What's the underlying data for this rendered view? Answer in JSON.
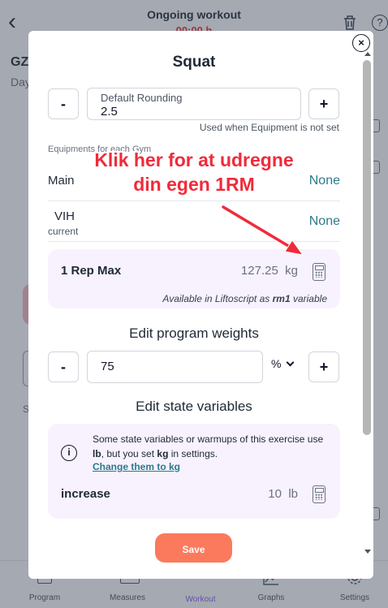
{
  "background": {
    "title": "Ongoing workout",
    "timer": "00:00 h",
    "program_short": "GZ",
    "day_short": "Day",
    "left_s": "S",
    "nav": [
      {
        "label": "Program"
      },
      {
        "label": "Measures"
      },
      {
        "label": "Workout"
      },
      {
        "label": "Graphs"
      },
      {
        "label": "Settings"
      }
    ]
  },
  "modal": {
    "title": "Squat",
    "rounding": {
      "label": "Default Rounding",
      "value": "2.5",
      "minus": "-",
      "plus": "+",
      "hint": "Used when Equipment is not set"
    },
    "gym_caption": "Equipments for each Gym",
    "gyms": [
      {
        "name": "Main",
        "sub": "",
        "value": "None"
      },
      {
        "name": "VIH",
        "sub": "current",
        "value": "None"
      }
    ],
    "one_rm": {
      "label": "1 Rep Max",
      "value": "127.25",
      "unit": "kg",
      "avail_prefix": "Available in Liftoscript as",
      "avail_var": "rm1",
      "avail_suffix": "variable"
    },
    "program_weights": {
      "title": "Edit program weights",
      "value": "75",
      "unit": "%",
      "minus": "-",
      "plus": "+"
    },
    "state_vars": {
      "title": "Edit state variables",
      "info_icon": "i",
      "info_text_1": "Some state variables or warmups of this exercise use",
      "info_lb": "lb",
      "info_text_2": ", but you set",
      "info_kg": "kg",
      "info_text_3": "in settings.",
      "link": "Change them to kg",
      "var_label": "increase",
      "var_value": "10",
      "var_unit": "lb"
    },
    "save_label": "Save",
    "close_glyph": "×"
  },
  "annotation": {
    "line1": "Klik her for at udregne",
    "line2": "din egen 1RM",
    "color": "#ef2b3b"
  },
  "colors": {
    "accent_teal": "#2b7a8c",
    "save_button": "#fb7a5d",
    "card_bg": "#f7f2fd"
  }
}
